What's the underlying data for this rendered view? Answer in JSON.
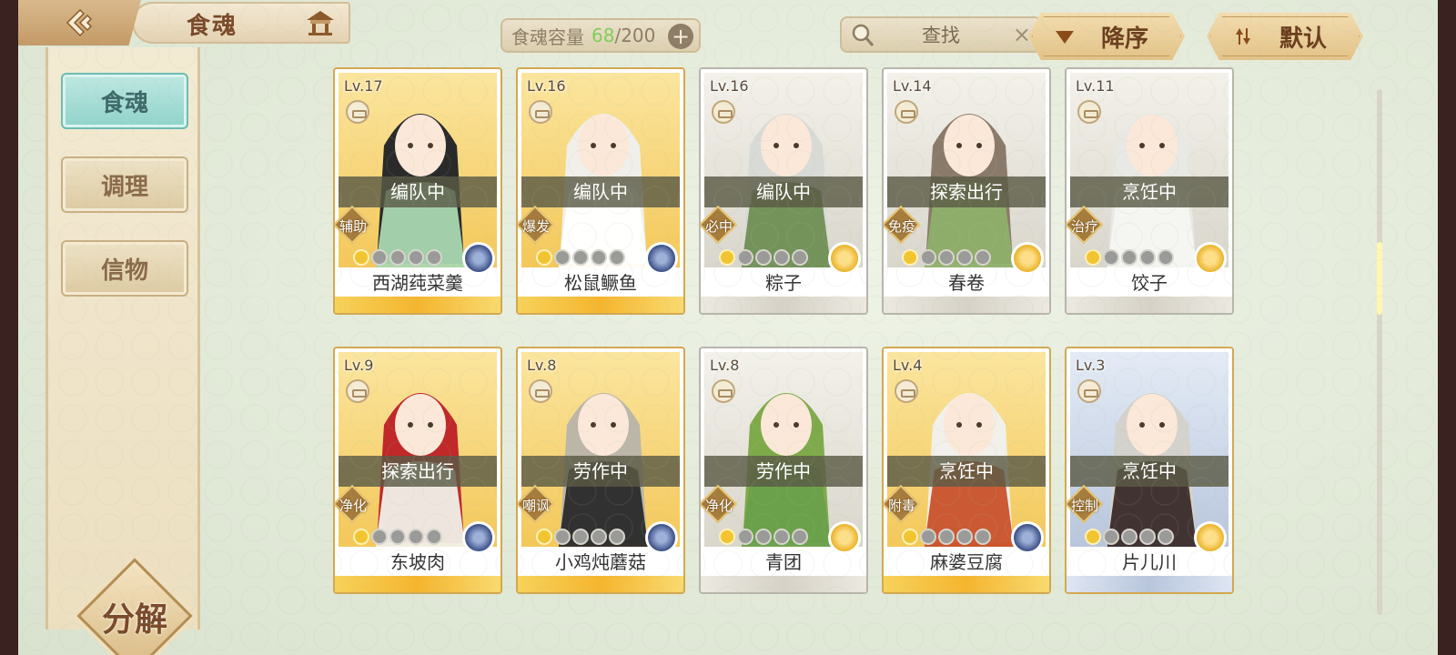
{
  "header": {
    "title": "食魂",
    "back_icon": "back-arrow-icon",
    "home_icon": "pavilion-home-icon"
  },
  "capacity": {
    "label": "食魂容量",
    "current": "68",
    "max": "/200",
    "plus": "+",
    "current_color": "#7fcf5a"
  },
  "search": {
    "placeholder": "查找",
    "clear": "×"
  },
  "sort": {
    "order_label": "降序",
    "filter_label": "默认"
  },
  "sidebar": {
    "items": [
      {
        "label": "食魂",
        "active": true
      },
      {
        "label": "调理",
        "active": false
      },
      {
        "label": "信物",
        "active": false
      }
    ],
    "decompose_label": "分解"
  },
  "cards": [
    {
      "level": "Lv.17",
      "status": "编队中",
      "role": "辅助",
      "stars_on": 1,
      "name": "西湖莼菜羹",
      "element": "navy",
      "frame": "gold"
    },
    {
      "level": "Lv.16",
      "status": "编队中",
      "role": "爆发",
      "stars_on": 1,
      "name": "松鼠鳜鱼",
      "element": "navy",
      "frame": "gold"
    },
    {
      "level": "Lv.16",
      "status": "编队中",
      "role": "必中",
      "stars_on": 1,
      "name": "粽子",
      "element": "gold",
      "frame": "silver"
    },
    {
      "level": "Lv.14",
      "status": "探索出行",
      "role": "免疫",
      "stars_on": 1,
      "name": "春卷",
      "element": "gold",
      "frame": "silver"
    },
    {
      "level": "Lv.11",
      "status": "烹饪中",
      "role": "治疗",
      "stars_on": 1,
      "name": "饺子",
      "element": "gold",
      "frame": "silver"
    },
    {
      "level": "Lv.9",
      "status": "探索出行",
      "role": "净化",
      "stars_on": 1,
      "name": "东坡肉",
      "element": "navy",
      "frame": "gold"
    },
    {
      "level": "Lv.8",
      "status": "劳作中",
      "role": "嘲讽",
      "stars_on": 1,
      "name": "小鸡炖蘑菇",
      "element": "navy",
      "frame": "gold"
    },
    {
      "level": "Lv.8",
      "status": "劳作中",
      "role": "净化",
      "stars_on": 1,
      "name": "青团",
      "element": "gold",
      "frame": "silver"
    },
    {
      "level": "Lv.4",
      "status": "烹饪中",
      "role": "附毒",
      "stars_on": 1,
      "name": "麻婆豆腐",
      "element": "navy",
      "frame": "gold"
    },
    {
      "level": "Lv.3",
      "status": "烹饪中",
      "role": "控制",
      "stars_on": 1,
      "name": "片儿川",
      "element": "gold",
      "frame": "blue"
    }
  ]
}
